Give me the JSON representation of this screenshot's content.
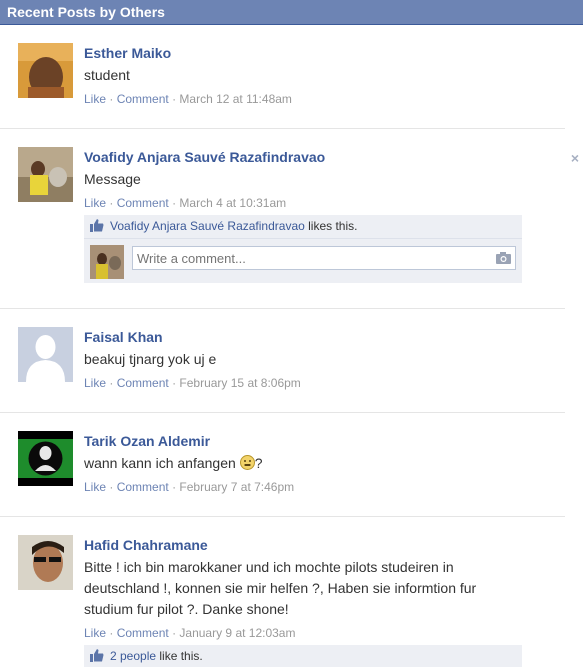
{
  "header": {
    "title": "Recent Posts by Others"
  },
  "posts": [
    {
      "name": "Esther Maiko",
      "message": "student",
      "actions": {
        "like": "Like",
        "comment": "Comment",
        "sep": "·",
        "time": "March 12 at 11:48am"
      }
    },
    {
      "name": "Voafidy Anjara Sauvé Razafindravao",
      "message": "Message",
      "actions": {
        "like": "Like",
        "comment": "Comment",
        "sep": "·",
        "time": "March 4 at 10:31am"
      },
      "likes": {
        "who": "Voafidy Anjara Sauvé Razafindravao",
        "suffix": " likes this."
      },
      "comment_placeholder": "Write a comment...",
      "close": "×"
    },
    {
      "name": "Faisal Khan",
      "message": "beakuj tjnarg yok uj e",
      "actions": {
        "like": "Like",
        "comment": "Comment",
        "sep": "·",
        "time": "February 15 at 8:06pm"
      }
    },
    {
      "name": "Tarik Ozan Aldemir",
      "message": "wann kann ich anfangen",
      "message_suffix": "?",
      "actions": {
        "like": "Like",
        "comment": "Comment",
        "sep": "·",
        "time": "February 7 at 7:46pm"
      }
    },
    {
      "name": "Hafid Chahramane",
      "message": "Bitte ! ich bin marokkaner und ich mochte pilots studeiren in deutschland !, konnen sie mir helfen ?, Haben sie informtion fur studium fur pilot ?. Danke shone!",
      "actions": {
        "like": "Like",
        "comment": "Comment",
        "sep": "·",
        "time": "January 9 at 12:03am"
      },
      "likes": {
        "who": "2 people",
        "suffix": " like this."
      }
    }
  ],
  "colors": {
    "header_bg": "#6d84b4",
    "link": "#3b5998",
    "meta": "#999999",
    "likes_bg": "#edeff4"
  },
  "icons": [
    "thumbs-up-icon",
    "camera-icon",
    "close-icon",
    "smiley-icon"
  ]
}
